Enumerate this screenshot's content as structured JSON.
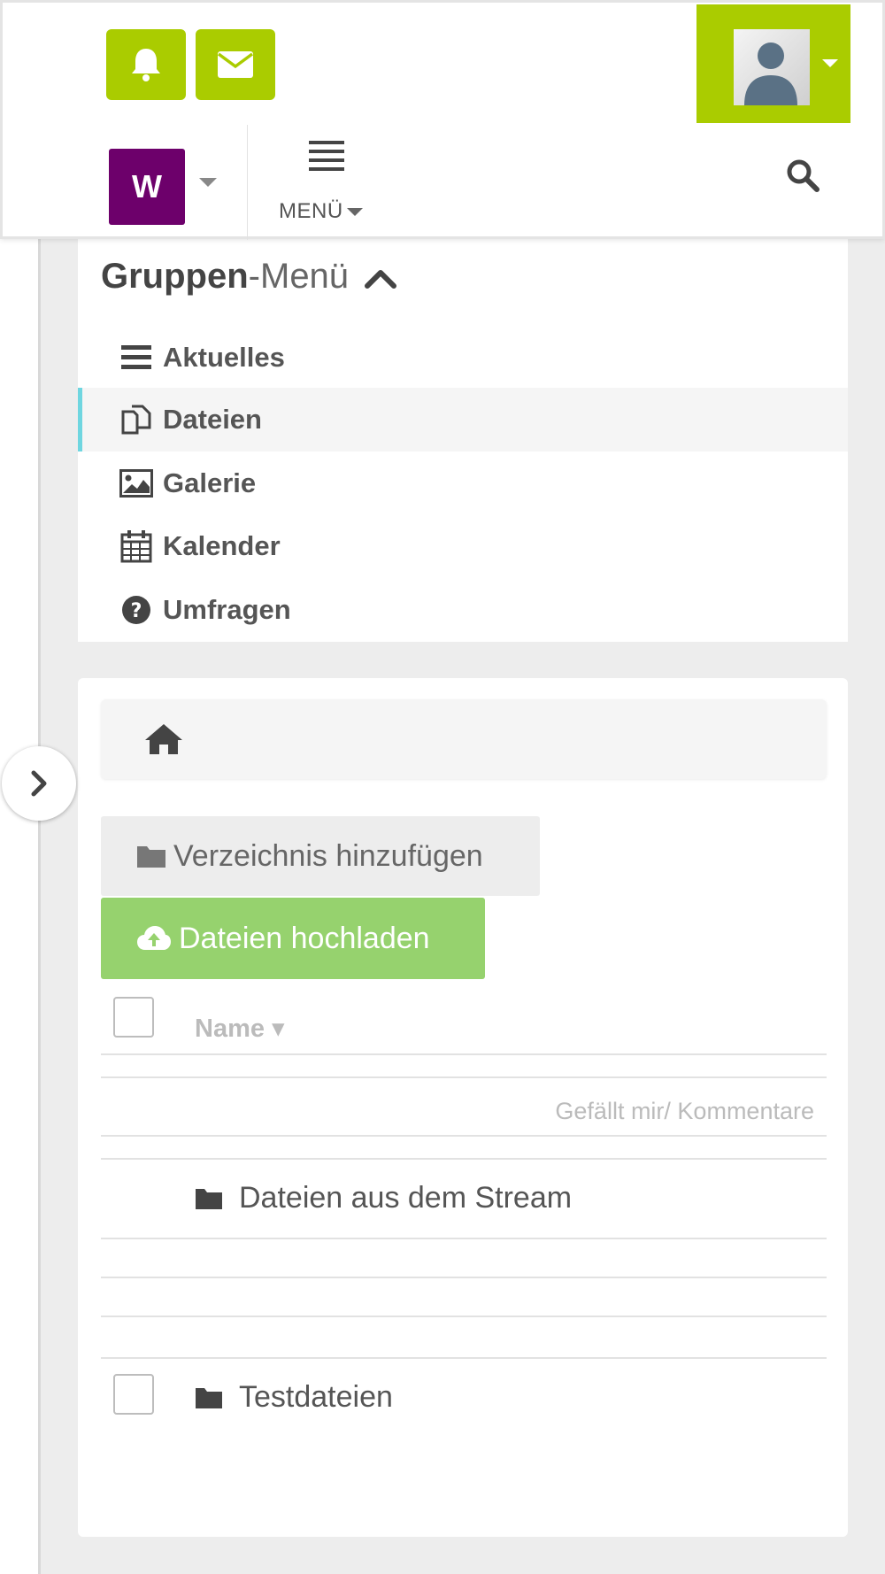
{
  "header": {
    "notifications_icon": "bell-icon",
    "messages_icon": "envelope-icon",
    "space_initial": "W",
    "menu_label": "MENÜ",
    "search_icon": "search-icon",
    "accent_color": "#aacc00",
    "space_color": "#6d006b"
  },
  "group_menu": {
    "title_bold": "Gruppen",
    "title_light": "-Menü",
    "items": [
      {
        "label": "Aktuelles",
        "icon": "list-icon",
        "active": false
      },
      {
        "label": "Dateien",
        "icon": "files-icon",
        "active": true
      },
      {
        "label": "Galerie",
        "icon": "image-icon",
        "active": false
      },
      {
        "label": "Kalender",
        "icon": "calendar-icon",
        "active": false
      },
      {
        "label": "Umfragen",
        "icon": "question-circle-icon",
        "active": false
      }
    ]
  },
  "files": {
    "breadcrumb_icon": "home-icon",
    "add_directory_label": "Verzeichnis hinzufügen",
    "upload_label": "Dateien hochladen",
    "column_name": "Name",
    "column_likes": "Gefällt mir/ Kommentare",
    "rows": [
      {
        "name": "Dateien aus dem Stream",
        "has_checkbox": false
      },
      {
        "name": "Testdateien",
        "has_checkbox": true
      }
    ]
  }
}
